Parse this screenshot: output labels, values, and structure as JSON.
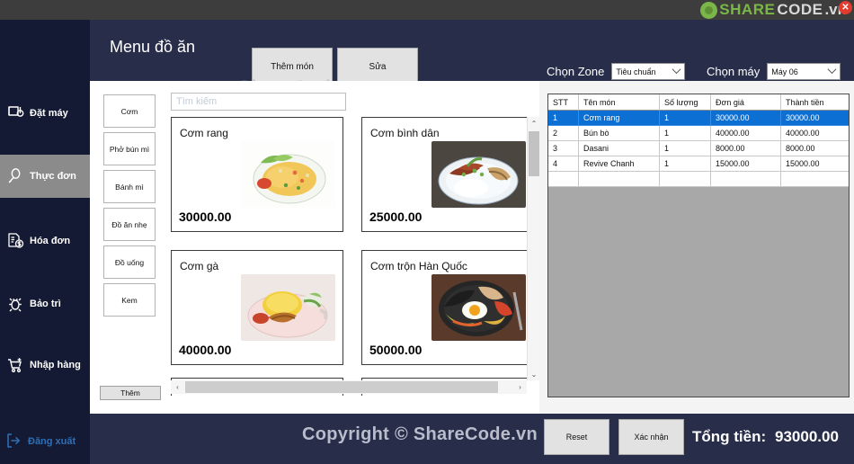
{
  "window": {
    "brand": {
      "share": "SHARE",
      "code": "CODE",
      "vn": ".vn"
    },
    "close_label": "✕"
  },
  "sidebar": {
    "items": [
      {
        "label": "Đặt máy",
        "icon": "monitor-icon",
        "active": false
      },
      {
        "label": "Thực đơn",
        "icon": "spoon-icon",
        "active": true
      },
      {
        "label": "Hóa đơn",
        "icon": "invoice-icon",
        "active": false
      },
      {
        "label": "Bảo trì",
        "icon": "bug-icon",
        "active": false
      },
      {
        "label": "Nhập hàng",
        "icon": "cart-plus-icon",
        "active": false
      }
    ],
    "logout": {
      "label": "Đăng xuất",
      "icon": "logout-icon",
      "color": "#2f6fb5"
    }
  },
  "header": {
    "title": "Menu đồ ăn",
    "add_item_label": "Thêm món",
    "edit_label": "Sửa",
    "watermark": "ShareCode.vn",
    "zone": {
      "label": "Chọn Zone",
      "value": "Tiêu chuẩn"
    },
    "machine": {
      "label": "Chọn máy",
      "value": "Máy 06"
    }
  },
  "menu_panel": {
    "search_placeholder": "Tìm kiếm",
    "search_value": "",
    "categories": [
      {
        "label": "Cơm"
      },
      {
        "label": "Phở bún mì"
      },
      {
        "label": "Bánh mì"
      },
      {
        "label": "Đồ ăn nhẹ"
      },
      {
        "label": "Đồ uống"
      },
      {
        "label": "Kem"
      }
    ],
    "add_category_label": "Thêm",
    "dishes": [
      {
        "name": "Cơm rang",
        "price": "30000.00",
        "image": "fried-rice-photo"
      },
      {
        "name": "Cơm bình dân",
        "price": "25000.00",
        "image": "rice-plate-photo"
      },
      {
        "name": "Cơm gà",
        "price": "40000.00",
        "image": "chicken-rice-photo"
      },
      {
        "name": "Cơm trộn Hàn Quốc",
        "price": "50000.00",
        "image": "bibimbap-photo"
      }
    ],
    "scroll": {
      "up": "⌃",
      "down": "⌄",
      "left": "‹",
      "right": "›"
    }
  },
  "order_grid": {
    "columns": [
      "STT",
      "Tên món",
      "Số lượng",
      "Đơn giá",
      "Thành tiền"
    ],
    "rows": [
      {
        "stt": "1",
        "name": "Cơm rang",
        "qty": "1",
        "price": "30000.00",
        "amount": "30000.00",
        "selected": true
      },
      {
        "stt": "2",
        "name": "Bún bò",
        "qty": "1",
        "price": "40000.00",
        "amount": "40000.00",
        "selected": false
      },
      {
        "stt": "3",
        "name": "Dasani",
        "qty": "1",
        "price": "8000.00",
        "amount": "8000.00",
        "selected": false
      },
      {
        "stt": "4",
        "name": "Revive Chanh",
        "qty": "1",
        "price": "15000.00",
        "amount": "15000.00",
        "selected": false
      },
      {
        "stt": "",
        "name": "",
        "qty": "",
        "price": "",
        "amount": "",
        "selected": false
      }
    ],
    "selection_color": "#0b6fd4"
  },
  "footer": {
    "copyright": "Copyright © ShareCode.vn",
    "reset_label": "Reset",
    "confirm_label": "Xác nhận",
    "total_label": "Tổng tiền:",
    "total_value": "93000.00"
  }
}
